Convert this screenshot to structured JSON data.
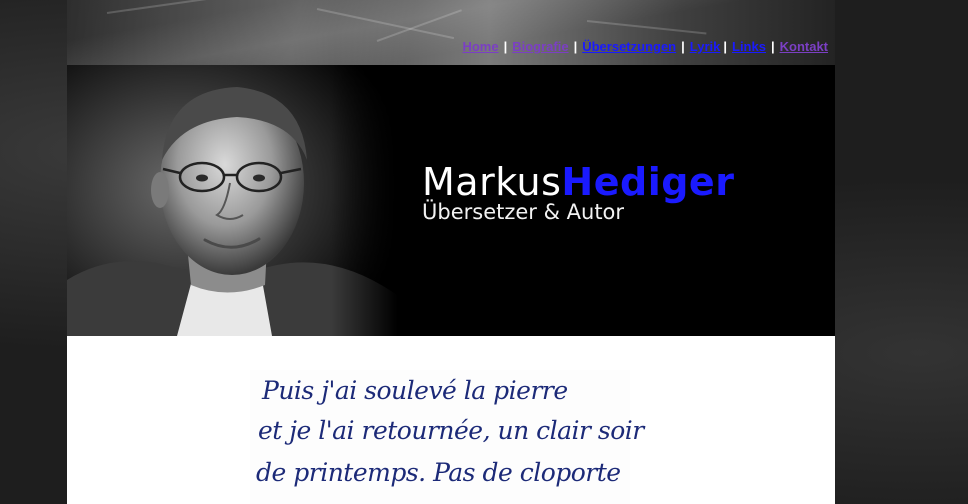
{
  "nav": {
    "items": [
      {
        "label": "Home",
        "color": "#7b3fc4"
      },
      {
        "label": "Biografie",
        "color": "#7b3fc4"
      },
      {
        "label": "Übersetzungen",
        "color": "#1a1aff"
      },
      {
        "label": "Lyrik",
        "color": "#7b3fc4"
      },
      {
        "label": "Links",
        "color": "#1a1aff"
      },
      {
        "label": "Kontakt",
        "color": "#7b3fc4"
      }
    ],
    "separator": "|"
  },
  "brand": {
    "first_name": "Markus",
    "last_name": "Hediger",
    "tagline": "Übersetzer & Autor",
    "accent_color": "#1a1aff"
  },
  "manuscript": {
    "lines": [
      "Puis j'ai soulevé la pierre",
      "et je l'ai retournée, un clair soir",
      "de printemps. Pas de cloporte"
    ],
    "ink_color": "#1c2a78"
  }
}
